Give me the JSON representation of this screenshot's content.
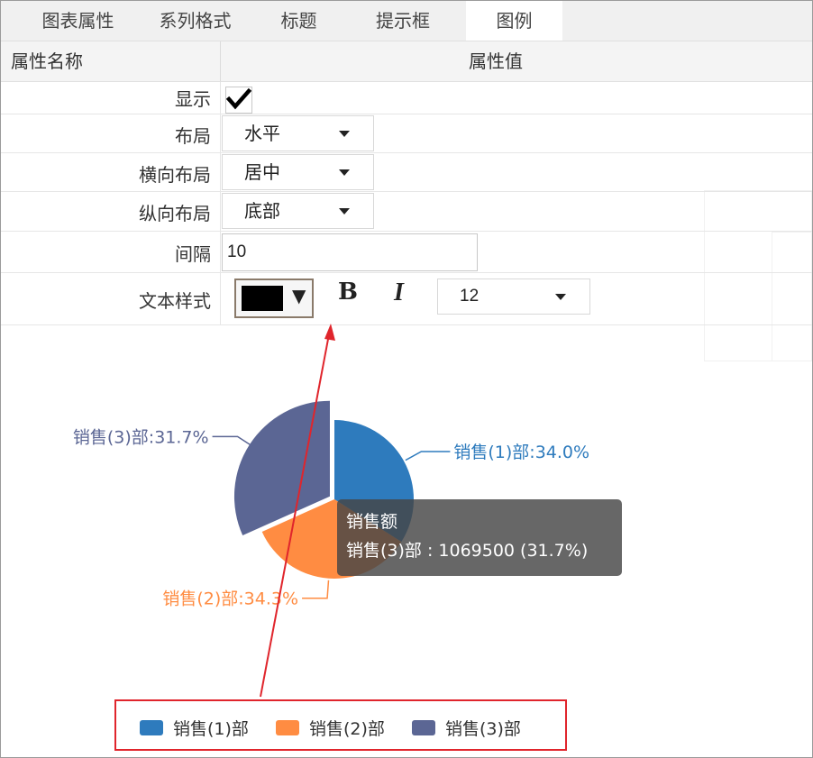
{
  "tabs": [
    {
      "label": "图表属性",
      "active": false
    },
    {
      "label": "系列格式",
      "active": false
    },
    {
      "label": "标题",
      "active": false
    },
    {
      "label": "提示框",
      "active": false
    },
    {
      "label": "图例",
      "active": true
    }
  ],
  "grid": {
    "header_name": "属性名称",
    "header_value": "属性值",
    "show": {
      "label": "显示",
      "checked": true
    },
    "layout": {
      "label": "布局",
      "value": "水平"
    },
    "h_align": {
      "label": "横向布局",
      "value": "居中"
    },
    "v_align": {
      "label": "纵向布局",
      "value": "底部"
    },
    "gap": {
      "label": "间隔",
      "value": "10"
    },
    "text_style": {
      "label": "文本样式",
      "color": "#000000",
      "bold_label": "B",
      "italic_label": "I",
      "font_size": "12"
    }
  },
  "colors": {
    "annotation_red": "#e0252c",
    "tooltip_bg": "#464646"
  },
  "chart_data": {
    "type": "pie",
    "categories": [
      "销售(1)部",
      "销售(2)部",
      "销售(3)部"
    ],
    "values": [
      34.0,
      34.3,
      31.7
    ],
    "labels": [
      "销售(1)部:34.0%",
      "销售(2)部:34.3%",
      "销售(3)部:31.7%"
    ],
    "colors": [
      "#2e7bbd",
      "#ff8c42",
      "#5b6694"
    ],
    "highlighted": 2,
    "legend": {
      "placement": "bottom-center",
      "entries": [
        "销售(1)部",
        "销售(2)部",
        "销售(3)部"
      ]
    },
    "tooltip": {
      "title": "销售额",
      "line": "销售(3)部 : 1069500 (31.7%)"
    }
  }
}
